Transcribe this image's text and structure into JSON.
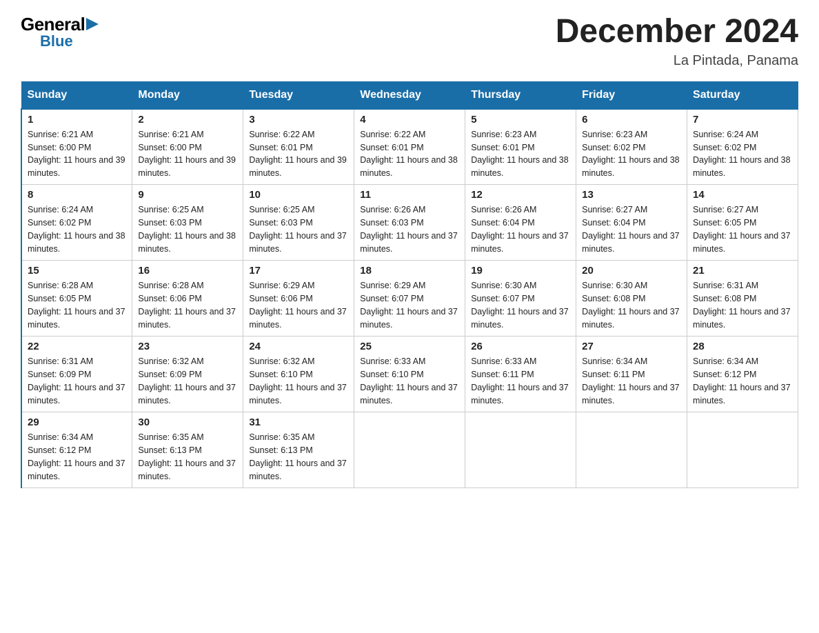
{
  "logo": {
    "general": "General",
    "blue": "Blue",
    "triangle": "▶"
  },
  "title": "December 2024",
  "subtitle": "La Pintada, Panama",
  "days_of_week": [
    "Sunday",
    "Monday",
    "Tuesday",
    "Wednesday",
    "Thursday",
    "Friday",
    "Saturday"
  ],
  "weeks": [
    [
      {
        "day": "1",
        "sunrise": "6:21 AM",
        "sunset": "6:00 PM",
        "daylight": "11 hours and 39 minutes."
      },
      {
        "day": "2",
        "sunrise": "6:21 AM",
        "sunset": "6:00 PM",
        "daylight": "11 hours and 39 minutes."
      },
      {
        "day": "3",
        "sunrise": "6:22 AM",
        "sunset": "6:01 PM",
        "daylight": "11 hours and 39 minutes."
      },
      {
        "day": "4",
        "sunrise": "6:22 AM",
        "sunset": "6:01 PM",
        "daylight": "11 hours and 38 minutes."
      },
      {
        "day": "5",
        "sunrise": "6:23 AM",
        "sunset": "6:01 PM",
        "daylight": "11 hours and 38 minutes."
      },
      {
        "day": "6",
        "sunrise": "6:23 AM",
        "sunset": "6:02 PM",
        "daylight": "11 hours and 38 minutes."
      },
      {
        "day": "7",
        "sunrise": "6:24 AM",
        "sunset": "6:02 PM",
        "daylight": "11 hours and 38 minutes."
      }
    ],
    [
      {
        "day": "8",
        "sunrise": "6:24 AM",
        "sunset": "6:02 PM",
        "daylight": "11 hours and 38 minutes."
      },
      {
        "day": "9",
        "sunrise": "6:25 AM",
        "sunset": "6:03 PM",
        "daylight": "11 hours and 38 minutes."
      },
      {
        "day": "10",
        "sunrise": "6:25 AM",
        "sunset": "6:03 PM",
        "daylight": "11 hours and 37 minutes."
      },
      {
        "day": "11",
        "sunrise": "6:26 AM",
        "sunset": "6:03 PM",
        "daylight": "11 hours and 37 minutes."
      },
      {
        "day": "12",
        "sunrise": "6:26 AM",
        "sunset": "6:04 PM",
        "daylight": "11 hours and 37 minutes."
      },
      {
        "day": "13",
        "sunrise": "6:27 AM",
        "sunset": "6:04 PM",
        "daylight": "11 hours and 37 minutes."
      },
      {
        "day": "14",
        "sunrise": "6:27 AM",
        "sunset": "6:05 PM",
        "daylight": "11 hours and 37 minutes."
      }
    ],
    [
      {
        "day": "15",
        "sunrise": "6:28 AM",
        "sunset": "6:05 PM",
        "daylight": "11 hours and 37 minutes."
      },
      {
        "day": "16",
        "sunrise": "6:28 AM",
        "sunset": "6:06 PM",
        "daylight": "11 hours and 37 minutes."
      },
      {
        "day": "17",
        "sunrise": "6:29 AM",
        "sunset": "6:06 PM",
        "daylight": "11 hours and 37 minutes."
      },
      {
        "day": "18",
        "sunrise": "6:29 AM",
        "sunset": "6:07 PM",
        "daylight": "11 hours and 37 minutes."
      },
      {
        "day": "19",
        "sunrise": "6:30 AM",
        "sunset": "6:07 PM",
        "daylight": "11 hours and 37 minutes."
      },
      {
        "day": "20",
        "sunrise": "6:30 AM",
        "sunset": "6:08 PM",
        "daylight": "11 hours and 37 minutes."
      },
      {
        "day": "21",
        "sunrise": "6:31 AM",
        "sunset": "6:08 PM",
        "daylight": "11 hours and 37 minutes."
      }
    ],
    [
      {
        "day": "22",
        "sunrise": "6:31 AM",
        "sunset": "6:09 PM",
        "daylight": "11 hours and 37 minutes."
      },
      {
        "day": "23",
        "sunrise": "6:32 AM",
        "sunset": "6:09 PM",
        "daylight": "11 hours and 37 minutes."
      },
      {
        "day": "24",
        "sunrise": "6:32 AM",
        "sunset": "6:10 PM",
        "daylight": "11 hours and 37 minutes."
      },
      {
        "day": "25",
        "sunrise": "6:33 AM",
        "sunset": "6:10 PM",
        "daylight": "11 hours and 37 minutes."
      },
      {
        "day": "26",
        "sunrise": "6:33 AM",
        "sunset": "6:11 PM",
        "daylight": "11 hours and 37 minutes."
      },
      {
        "day": "27",
        "sunrise": "6:34 AM",
        "sunset": "6:11 PM",
        "daylight": "11 hours and 37 minutes."
      },
      {
        "day": "28",
        "sunrise": "6:34 AM",
        "sunset": "6:12 PM",
        "daylight": "11 hours and 37 minutes."
      }
    ],
    [
      {
        "day": "29",
        "sunrise": "6:34 AM",
        "sunset": "6:12 PM",
        "daylight": "11 hours and 37 minutes."
      },
      {
        "day": "30",
        "sunrise": "6:35 AM",
        "sunset": "6:13 PM",
        "daylight": "11 hours and 37 minutes."
      },
      {
        "day": "31",
        "sunrise": "6:35 AM",
        "sunset": "6:13 PM",
        "daylight": "11 hours and 37 minutes."
      },
      null,
      null,
      null,
      null
    ]
  ],
  "accent_color": "#1a6ea8"
}
